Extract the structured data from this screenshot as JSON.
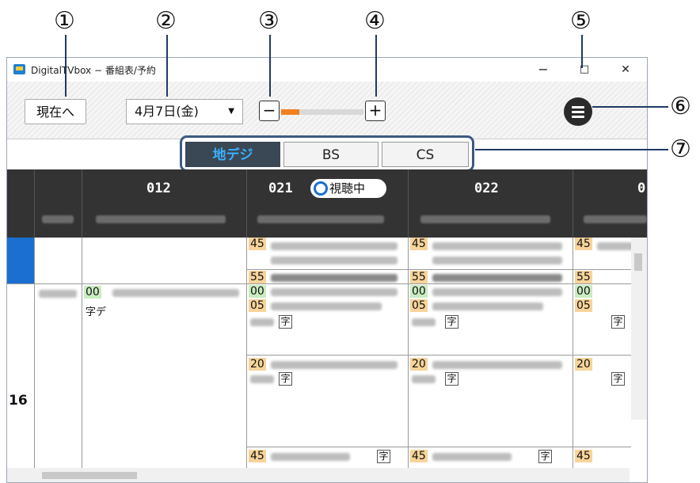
{
  "callouts": [
    "①",
    "②",
    "③",
    "④",
    "⑤",
    "⑥",
    "⑦"
  ],
  "window": {
    "title": "DigitalTVbox − 番組表/予約",
    "minimize": "−",
    "maximize": "□",
    "close": "✕"
  },
  "toolbar": {
    "now_label": "現在へ",
    "date_value": "4月7日(金)",
    "zoom_out": "−",
    "zoom_in": "+",
    "zoom_level_fraction": 0.22,
    "colors": {
      "zoom_fill": "#f08020"
    }
  },
  "tabs": [
    {
      "label": "地デジ",
      "active": true
    },
    {
      "label": "BS",
      "active": false
    },
    {
      "label": "CS",
      "active": false
    }
  ],
  "channels": [
    {
      "number": "012"
    },
    {
      "number": "021",
      "watching_label": "視聴中"
    },
    {
      "number": "022"
    },
    {
      "number": "0"
    }
  ],
  "schedule": {
    "hour_label": "16",
    "col1": {
      "time_a": "00",
      "icons": "字デ"
    },
    "col2": {
      "t45": "45",
      "t55": "55",
      "t00": "00",
      "t05": "05",
      "t20": "20",
      "t45b": "45",
      "ji": "字"
    },
    "col3": {
      "t45": "45",
      "t55": "55",
      "t00": "00",
      "t05": "05",
      "t20": "20",
      "t45b": "45",
      "ji": "字"
    },
    "col4": {
      "t45": "45",
      "t55": "55",
      "t00": "00",
      "t05": "05",
      "t20": "20",
      "t45b": "45",
      "ji": "字"
    }
  },
  "colors": {
    "accent": "#1a6fd1",
    "header_bg": "#333333",
    "active_tab_text": "#3ab0ff"
  }
}
